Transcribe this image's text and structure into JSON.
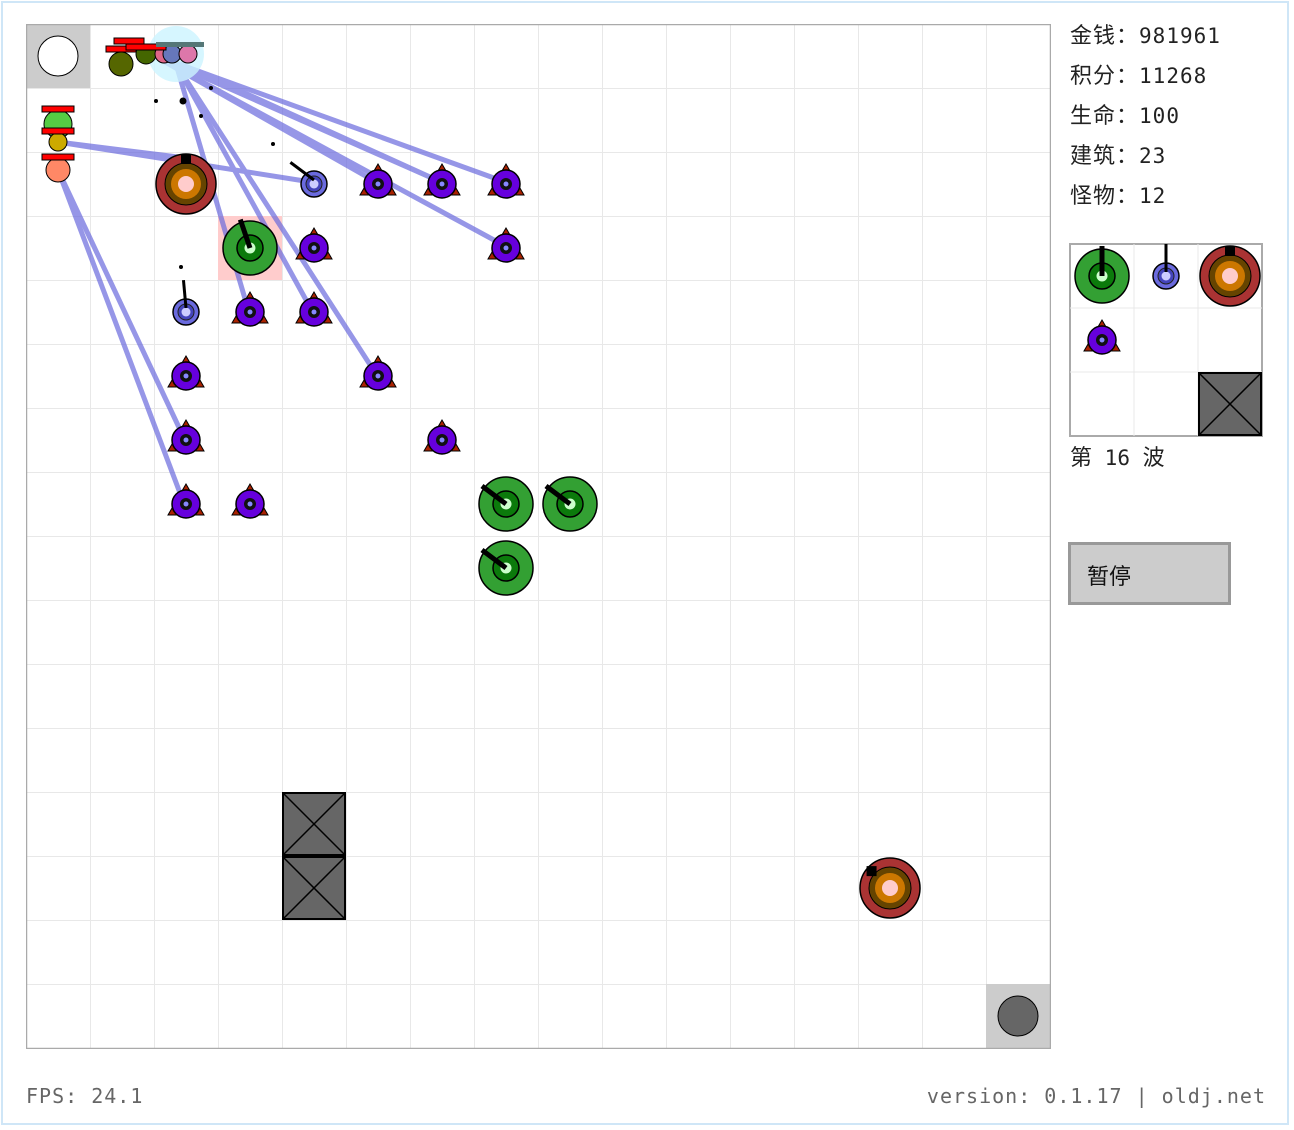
{
  "stats": [
    {
      "label": "金钱",
      "value": "981961"
    },
    {
      "label": "积分",
      "value": "11268"
    },
    {
      "label": "生命",
      "value": "100"
    },
    {
      "label": "建筑",
      "value": "23"
    },
    {
      "label": "怪物",
      "value": "12"
    }
  ],
  "wave": {
    "prefix": "第",
    "number": "16",
    "suffix": "波"
  },
  "pause_label": "暂停",
  "fps_text": "FPS: 24.1",
  "version_text": "version: 0.1.17 | oldj.net",
  "board": {
    "columns": 16,
    "rows": 16
  },
  "colors": {
    "grid_line": "#e8e8e8",
    "board_border": "#aaaaaa",
    "portal_bg": "#cccccc",
    "laser": "#6a6add",
    "cannon_green": "#33a033",
    "laser_tower_blue": "#6a6ade",
    "heavy_tower_red": "#aa3333",
    "purple_tower": "#6600dd",
    "wall": "#666666",
    "selected_cell": "#ffcccc",
    "monster_hp": "#ff0000"
  },
  "entrance_icon": "circle-portal-entrance",
  "exit_icon": "circle-portal-exit",
  "towers": [
    {
      "type": "heavy",
      "col": 2,
      "row": 2
    },
    {
      "type": "cannon",
      "col": 3,
      "row": 3,
      "selected": true
    },
    {
      "type": "laser",
      "col": 4,
      "row": 2
    },
    {
      "type": "laser",
      "col": 2,
      "row": 4
    },
    {
      "type": "purple",
      "col": 5,
      "row": 2
    },
    {
      "type": "purple",
      "col": 6,
      "row": 2
    },
    {
      "type": "purple",
      "col": 7,
      "row": 2
    },
    {
      "type": "purple",
      "col": 4,
      "row": 3
    },
    {
      "type": "purple",
      "col": 7,
      "row": 3
    },
    {
      "type": "purple",
      "col": 3,
      "row": 4
    },
    {
      "type": "purple",
      "col": 4,
      "row": 4
    },
    {
      "type": "purple",
      "col": 2,
      "row": 5
    },
    {
      "type": "purple",
      "col": 5,
      "row": 5
    },
    {
      "type": "purple",
      "col": 2,
      "row": 6
    },
    {
      "type": "purple",
      "col": 6,
      "row": 6
    },
    {
      "type": "purple",
      "col": 2,
      "row": 7
    },
    {
      "type": "purple",
      "col": 3,
      "row": 7
    },
    {
      "type": "cannon",
      "col": 7,
      "row": 7
    },
    {
      "type": "cannon",
      "col": 8,
      "row": 7
    },
    {
      "type": "cannon",
      "col": 7,
      "row": 8
    },
    {
      "type": "heavy",
      "col": 13,
      "row": 13
    },
    {
      "type": "wall",
      "col": 4,
      "row": 12
    },
    {
      "type": "wall",
      "col": 4,
      "row": 13
    }
  ],
  "palette": [
    "cannon",
    "laser",
    "heavy",
    "purple",
    "empty",
    "empty",
    "empty",
    "empty",
    "wall"
  ]
}
